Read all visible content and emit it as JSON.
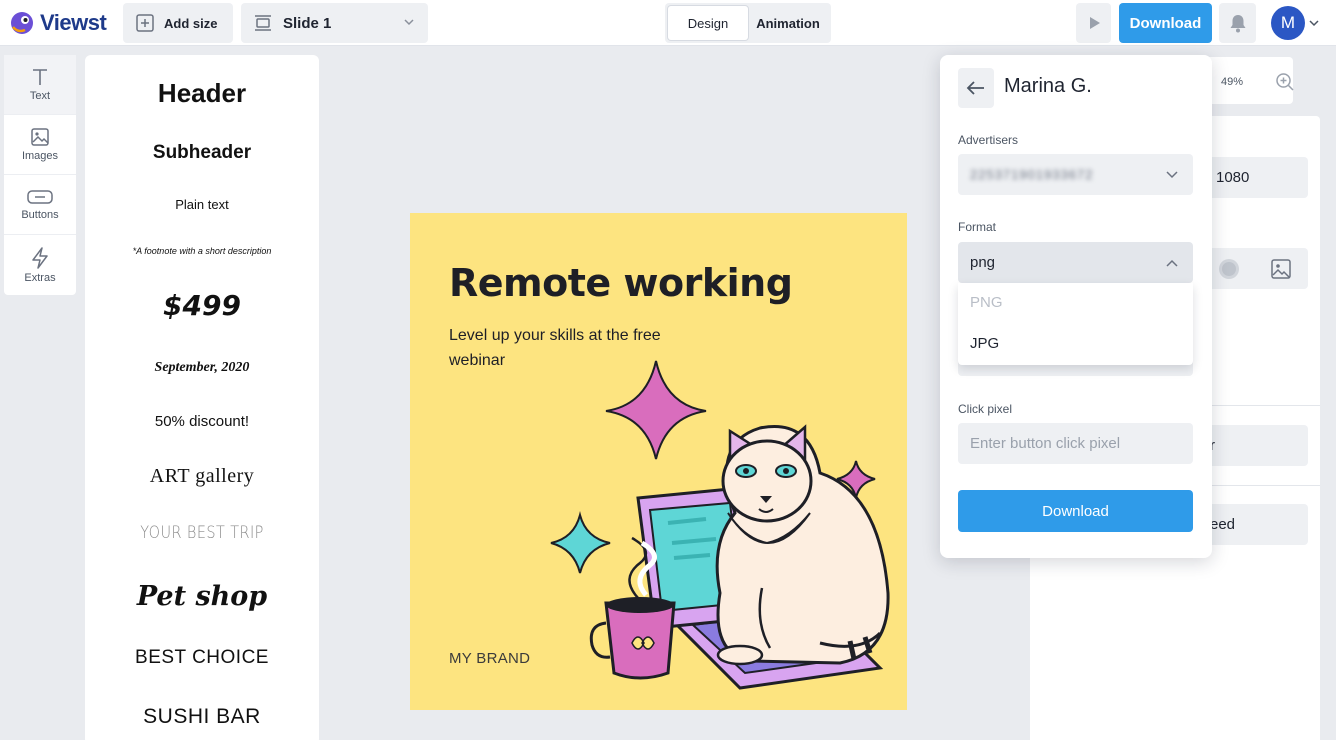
{
  "app": {
    "name": "Viewst"
  },
  "toolbar": {
    "add_size_label": "Add size",
    "slide_label": "Slide 1",
    "design_tab": "Design",
    "animation_tab": "Animation",
    "download_label": "Download",
    "avatar_initial": "M",
    "accent_color": "#2f9be9"
  },
  "rail": {
    "items": [
      {
        "label": "Text",
        "icon": "text-icon"
      },
      {
        "label": "Images",
        "icon": "image-icon"
      },
      {
        "label": "Buttons",
        "icon": "button-icon"
      },
      {
        "label": "Extras",
        "icon": "lightning-icon"
      }
    ]
  },
  "presets": {
    "items": [
      "Header",
      "Subheader",
      "Plain text",
      "*A footnote with a short description",
      "$499",
      "September, 2020",
      "50% discount!",
      "ART gallery",
      "YOUR BEST TRIP",
      "Pet shop",
      "BEST CHOICE",
      "SUSHI BAR"
    ]
  },
  "canvas": {
    "headline": "Remote working",
    "subtitle": "Level up your skills at the free webinar",
    "brand": "MY BRAND",
    "background_color": "#fde480"
  },
  "right_panel": {
    "zoom": "49%",
    "size_value": "1080",
    "partial_label_1": "r",
    "partial_label_2": "eed"
  },
  "download_popover": {
    "user_name": "Marina G.",
    "advertisers_label": "Advertisers",
    "advertiser_value": "225371901933672",
    "format_label": "Format",
    "format_value": "png",
    "format_options": [
      "PNG",
      "JPG"
    ],
    "click_pixel_label": "Click pixel",
    "click_pixel_placeholder": "Enter button click pixel",
    "download_button": "Download"
  }
}
